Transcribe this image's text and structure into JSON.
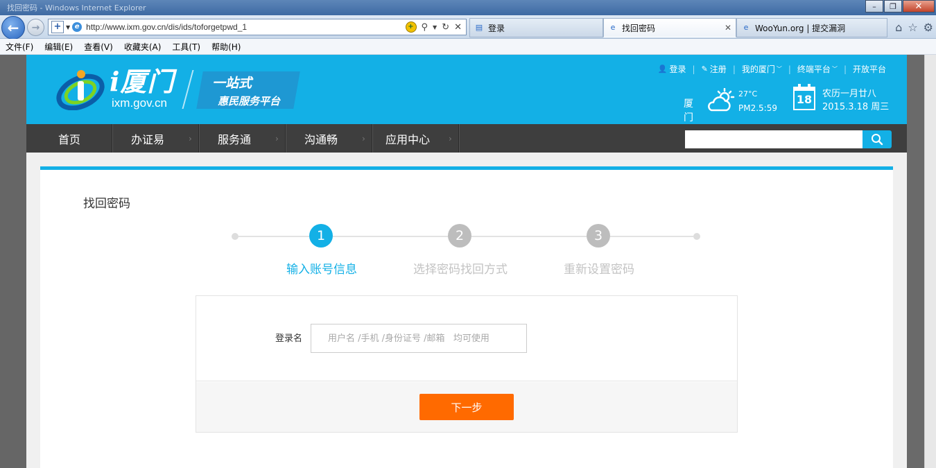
{
  "browser": {
    "window_title": "找回密码 - Windows Internet Explorer",
    "url": "http://www.ixm.gov.cn/dis/ids/toforgetpwd_1",
    "tabs": [
      {
        "label": "登录",
        "active": false
      },
      {
        "label": "找回密码",
        "active": true
      },
      {
        "label": "WooYun.org | 提交漏洞",
        "active": false
      }
    ],
    "menu": [
      "文件(F)",
      "编辑(E)",
      "查看(V)",
      "收藏夹(A)",
      "工具(T)",
      "帮助(H)"
    ],
    "icons": {
      "back": "back-arrow-icon",
      "forward": "forward-arrow-icon",
      "home": "home-icon",
      "favorites": "star-icon",
      "tools": "gear-icon"
    }
  },
  "header": {
    "brand": "i厦门",
    "domain": "ixm.gov.cn",
    "slogan_1": "一站式",
    "slogan_2": "惠民服务平台",
    "top_links": {
      "login": "登录",
      "register": "注册",
      "my_xiamen": "我的厦门",
      "terminal": "终端平台",
      "open": "开放平台"
    },
    "weather": {
      "city": "厦门",
      "temp": "27°C",
      "pm25": "PM2.5:59"
    },
    "calendar": {
      "day": "18",
      "lunar": "农历一月廿八",
      "solar": "2015.3.18 周三"
    },
    "colors": {
      "primary": "#13b0e6",
      "nav": "#3e3e3e",
      "cta": "#ff6a00"
    }
  },
  "nav": {
    "items": [
      "首页",
      "办证易",
      "服务通",
      "沟通畅",
      "应用中心"
    ],
    "search_placeholder": ""
  },
  "main": {
    "title": "找回密码",
    "steps": [
      {
        "num": "1",
        "label": "输入账号信息",
        "active": true
      },
      {
        "num": "2",
        "label": "选择密码找回方式",
        "active": false
      },
      {
        "num": "3",
        "label": "重新设置密码",
        "active": false
      }
    ],
    "form": {
      "login_label": "登录名",
      "login_value": "",
      "login_placeholder": "用户名 /手机 /身份证号 /邮箱   均可使用",
      "next_label": "下一步"
    }
  }
}
